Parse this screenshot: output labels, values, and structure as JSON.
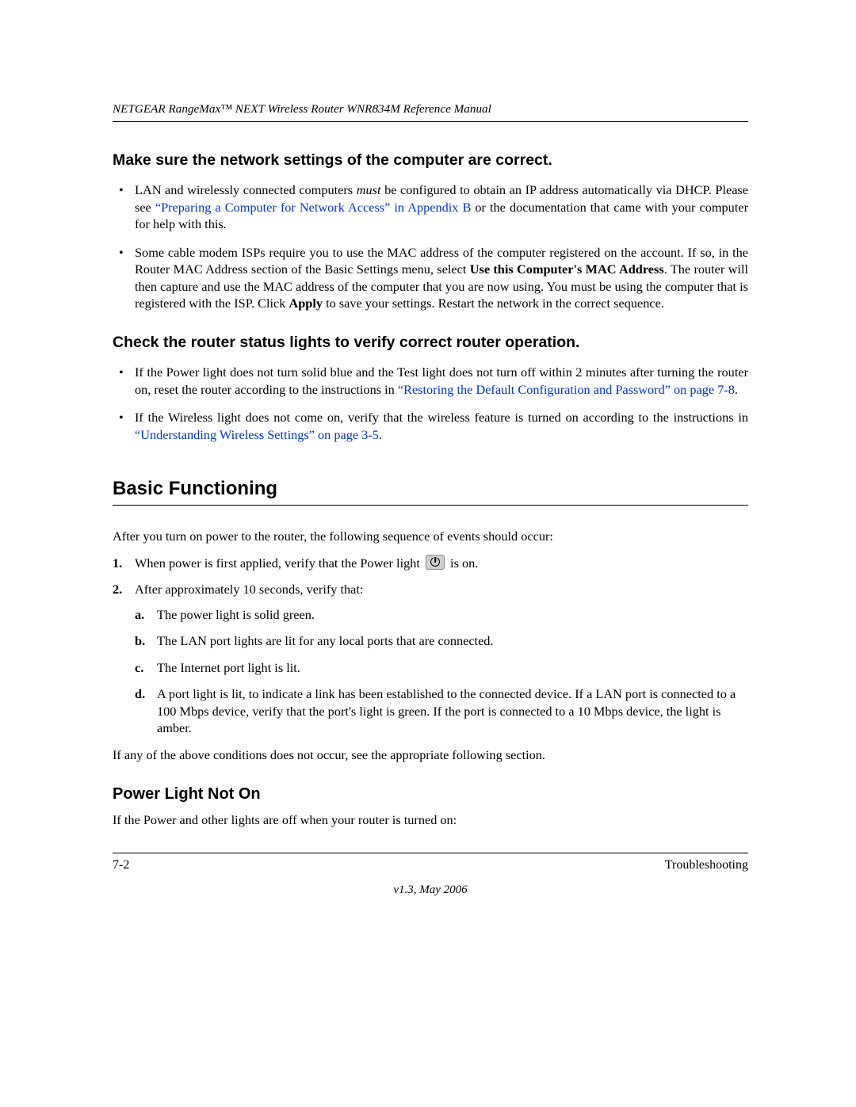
{
  "header": {
    "running": "NETGEAR RangeMax™ NEXT Wireless Router WNR834M Reference Manual"
  },
  "section1": {
    "title": "Make sure the network settings of the computer are correct.",
    "b1a": "LAN and wirelessly connected computers ",
    "b1b_italic": "must",
    "b1c": " be configured to obtain an IP address automatically via DHCP. Please see ",
    "b1_link": "“Preparing a Computer for Network Access” in Appendix B",
    "b1d": " or the documentation that came with your computer for help with this",
    "b1e": ".",
    "b2a": "Some cable modem ISPs require you to use the MAC address of the computer registered on the account. If so, in the Router MAC Address section of the Basic Settings menu, select ",
    "b2b_bold": "Use this Computer's MAC Address",
    "b2c": ". The router will then capture and use the MAC address of the computer that you are now using. You must be using the computer that is registered with the ISP. Click ",
    "b2d_bold": "Apply",
    "b2e": " to save your settings. Restart the network in the correct sequence."
  },
  "section2": {
    "title": "Check the router status lights to verify correct router operation.",
    "b1a": "If the Power light does not turn solid blue and the Test light does not turn off within 2 minutes after turning the router on, reset the router according to the instructions in ",
    "b1_link": "“Restoring the Default Configuration and Password” on page 7-8",
    "b1b": ".",
    "b2a": "If the Wireless light does not come on, verify that the wireless feature is turned on according to the instructions in ",
    "b2_link": "“Understanding Wireless Settings” on page 3-5",
    "b2b": "."
  },
  "section3": {
    "title": "Basic Functioning",
    "intro": "After you turn on power to the router, the following sequence of events should occur:",
    "n1a": "When power is first applied, verify that the Power light ",
    "n1b": " is on.",
    "n2": "After approximately 10 seconds, verify that:",
    "a": "The power light is solid green.",
    "b": "The LAN port lights are lit for any local ports that are connected.",
    "c": "The Internet port light is lit.",
    "d": "A port light is lit, to indicate a link has been established to the connected device. If a LAN port is connected to a 100 Mbps device, verify that the port's light is green. If the port is connected to a 10 Mbps device, the light is amber.",
    "after": "If any of the above conditions does not occur, see the appropriate following section."
  },
  "section4": {
    "title": "Power Light Not On",
    "p": "If the Power and other lights are off when your router is turned on:"
  },
  "footer": {
    "left": "7-2",
    "right": "Troubleshooting",
    "center": "v1.3, May 2006"
  }
}
